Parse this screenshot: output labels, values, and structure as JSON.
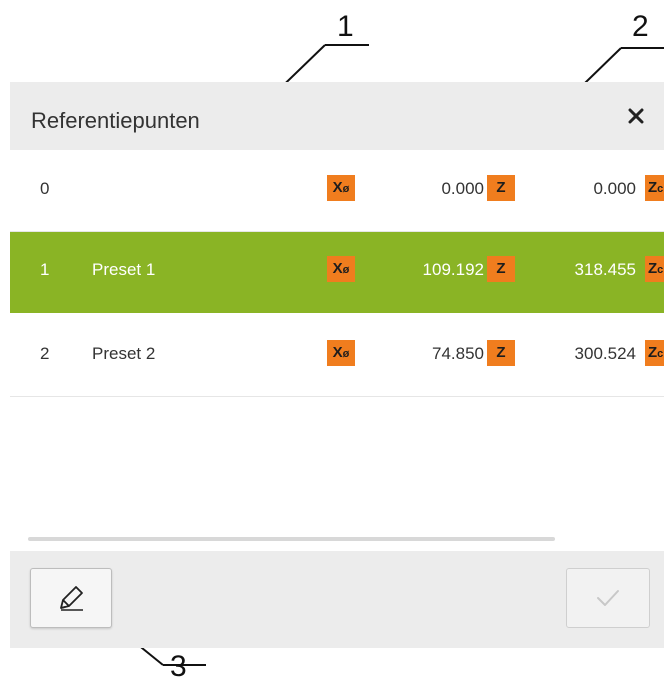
{
  "callouts": [
    "1",
    "2",
    "3"
  ],
  "dialog": {
    "title": "Referentiepunten",
    "close_icon": "close-icon"
  },
  "rows": [
    {
      "index": "0",
      "name": "",
      "x_label": "X",
      "x_sub": "ø",
      "x_value": "0.000",
      "z_label": "Z",
      "z_value": "0.000",
      "zc_label": "Z",
      "zc_sub": "c"
    },
    {
      "index": "1",
      "name": "Preset 1",
      "x_label": "X",
      "x_sub": "ø",
      "x_value": "109.192",
      "z_label": "Z",
      "z_value": "318.455",
      "zc_label": "Z",
      "zc_sub": "c"
    },
    {
      "index": "2",
      "name": "Preset 2",
      "x_label": "X",
      "x_sub": "ø",
      "x_value": "74.850",
      "z_label": "Z",
      "z_value": "300.524",
      "zc_label": "Z",
      "zc_sub": "c"
    }
  ],
  "selected_row": 1,
  "footer": {
    "edit_icon": "pencil-icon",
    "confirm_icon": "check-icon"
  },
  "colors": {
    "selection": "#8ab425",
    "axis_badge": "#f07d1e",
    "panel": "#ececec"
  }
}
